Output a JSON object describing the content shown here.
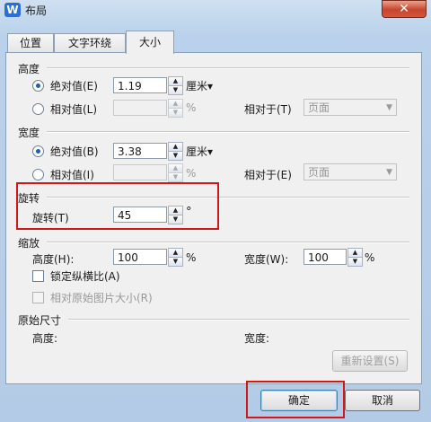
{
  "titlebar": {
    "icon": "W",
    "title": "布局",
    "close": "✕"
  },
  "tabs": [
    {
      "label": "位置",
      "active": false
    },
    {
      "label": "文字环绕",
      "active": false
    },
    {
      "label": "大小",
      "active": true
    }
  ],
  "height": {
    "title": "高度",
    "absolute_label": "绝对值(E)",
    "absolute_value": "1.19",
    "unit": "厘米▾",
    "relative_label": "相对值(L)",
    "relative_unit": "%",
    "relative_to_label": "相对于(T)",
    "relative_to_value": "页面"
  },
  "width": {
    "title": "宽度",
    "absolute_label": "绝对值(B)",
    "absolute_value": "3.38",
    "unit": "厘米▾",
    "relative_label": "相对值(I)",
    "relative_unit": "%",
    "relative_to_label": "相对于(E)",
    "relative_to_value": "页面"
  },
  "rotation": {
    "title": "旋转",
    "label": "旋转(T)",
    "value": "45",
    "unit": "°"
  },
  "scale": {
    "title": "缩放",
    "height_label": "高度(H):",
    "height_value": "100",
    "height_unit": "%",
    "width_label": "宽度(W):",
    "width_value": "100",
    "width_unit": "%",
    "lock_ratio_label": "锁定纵横比(A)",
    "relative_original_label": "相对原始图片大小(R)"
  },
  "original": {
    "title": "原始尺寸",
    "height_label": "高度:",
    "width_label": "宽度:",
    "reset_label": "重新设置(S)"
  },
  "footer": {
    "ok_label": "确定",
    "cancel_label": "取消"
  }
}
